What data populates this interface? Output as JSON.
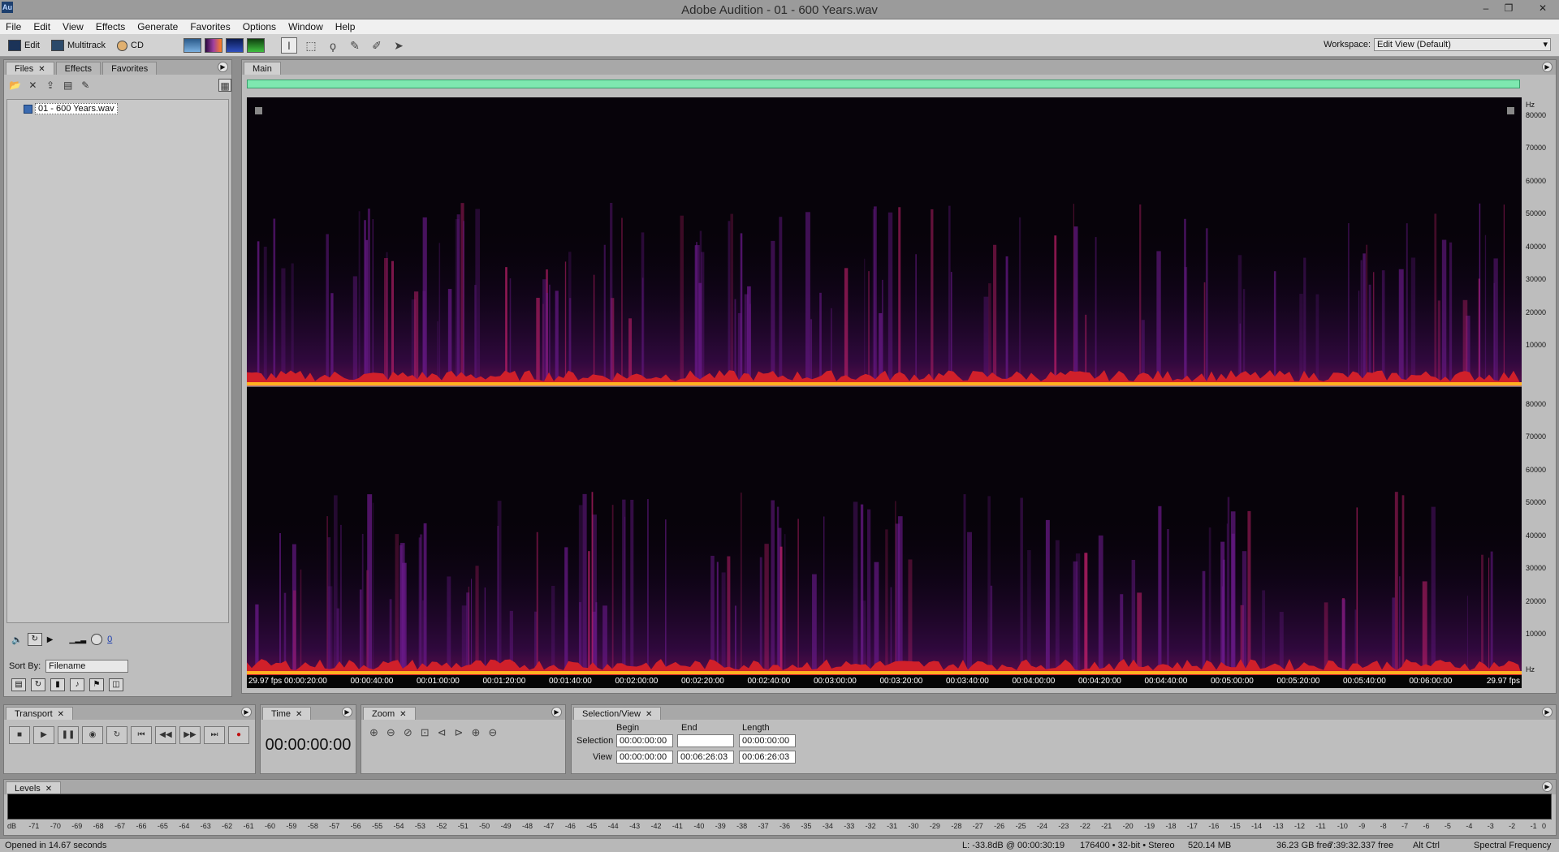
{
  "window": {
    "title": "Adobe Audition - 01 - 600 Years.wav",
    "app_icon": "Au"
  },
  "menu": [
    "File",
    "Edit",
    "View",
    "Effects",
    "Generate",
    "Favorites",
    "Options",
    "Window",
    "Help"
  ],
  "toolbar": {
    "modes": [
      {
        "label": "Edit",
        "icon": "edit-view-icon"
      },
      {
        "label": "Multitrack",
        "icon": "multitrack-icon"
      },
      {
        "label": "CD",
        "icon": "cd-icon"
      }
    ],
    "view_buttons": [
      "waveform-view-icon",
      "spectral-frequency-view-icon",
      "spectral-pan-view-icon",
      "spectral-phase-view-icon"
    ],
    "tools": [
      "time-selection-tool-icon",
      "marquee-selection-tool-icon",
      "lasso-selection-tool-icon",
      "effects-paintbrush-tool-icon",
      "spot-healing-brush-tool-icon",
      "scrub-tool-icon"
    ],
    "workspace_label": "Workspace:",
    "workspace_value": "Edit View (Default)"
  },
  "files_panel": {
    "tabs": [
      "Files",
      "Effects",
      "Favorites"
    ],
    "active_tab": "Files",
    "file": "01 - 600 Years.wav",
    "sort_by_label": "Sort By:",
    "sort_by_value": "Filename",
    "volume_value": "0"
  },
  "main_panel": {
    "tab": "Main",
    "overview_color": "#7ee8b0"
  },
  "spectral": {
    "hz_label": "Hz",
    "hz_ticks": [
      "80000",
      "70000",
      "60000",
      "50000",
      "40000",
      "30000",
      "20000",
      "10000"
    ],
    "fps_left": "29.97 fps",
    "fps_right": "29.97 fps",
    "time_ticks": [
      "00:00:20:00",
      "00:00:40:00",
      "00:01:00:00",
      "00:01:20:00",
      "00:01:40:00",
      "00:02:00:00",
      "00:02:20:00",
      "00:02:40:00",
      "00:03:00:00",
      "00:03:20:00",
      "00:03:40:00",
      "00:04:00:00",
      "00:04:20:00",
      "00:04:40:00",
      "00:05:00:00",
      "00:05:20:00",
      "00:05:40:00",
      "00:06:00:00"
    ]
  },
  "transport": {
    "tab": "Transport",
    "buttons": [
      "stop-icon",
      "play-icon",
      "pause-icon",
      "play-from-cursor-icon",
      "loop-icon",
      "go-to-beginning-icon",
      "rewind-icon",
      "fast-forward-icon",
      "go-to-end-icon",
      "record-icon"
    ]
  },
  "time_panel": {
    "tab": "Time",
    "value": "00:00:00:00"
  },
  "zoom_panel": {
    "tab": "Zoom",
    "buttons": [
      "zoom-in-horizontal-icon",
      "zoom-out-horizontal-icon",
      "zoom-out-full-icon",
      "zoom-to-selection-icon",
      "zoom-to-left-icon",
      "zoom-to-right-icon",
      "zoom-in-vertical-icon",
      "zoom-out-vertical-icon"
    ]
  },
  "selection_view": {
    "tab": "Selection/View",
    "headers": [
      "Begin",
      "End",
      "Length"
    ],
    "selection_label": "Selection",
    "view_label": "View",
    "selection": [
      "00:00:00:00",
      "",
      "00:00:00:00"
    ],
    "view": [
      "00:00:00:00",
      "00:06:26:03",
      "00:06:26:03"
    ]
  },
  "levels": {
    "tab": "Levels",
    "scale": [
      "dB",
      "-71",
      "-70",
      "-69",
      "-68",
      "-67",
      "-66",
      "-65",
      "-64",
      "-63",
      "-62",
      "-61",
      "-60",
      "-59",
      "-58",
      "-57",
      "-56",
      "-55",
      "-54",
      "-53",
      "-52",
      "-51",
      "-50",
      "-49",
      "-48",
      "-47",
      "-46",
      "-45",
      "-44",
      "-43",
      "-42",
      "-41",
      "-40",
      "-39",
      "-38",
      "-37",
      "-36",
      "-35",
      "-34",
      "-33",
      "-32",
      "-31",
      "-30",
      "-29",
      "-28",
      "-27",
      "-26",
      "-25",
      "-24",
      "-23",
      "-22",
      "-21",
      "-20",
      "-19",
      "-18",
      "-17",
      "-16",
      "-15",
      "-14",
      "-13",
      "-12",
      "-11",
      "-10",
      "-9",
      "-8",
      "-7",
      "-6",
      "-5",
      "-4",
      "-3",
      "-2",
      "-1",
      "0"
    ]
  },
  "status": {
    "message": "Opened in 14.67 seconds",
    "level": "L: -33.8dB @ 00:00:30:19",
    "format": "176400 • 32-bit • Stereo",
    "size": "520.14 MB",
    "free": "36.23 GB free",
    "free_time": "7:39:32.337 free",
    "key": "Alt Ctrl",
    "view": "Spectral Frequency"
  }
}
